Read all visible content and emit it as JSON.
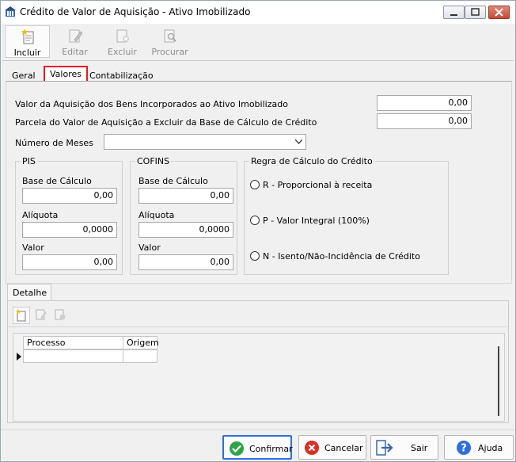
{
  "window": {
    "title": "Crédito de Valor de Aquisição - Ativo Imobilizado",
    "colors": {
      "accent": "#2f6fd6",
      "highlight": "#e31b23",
      "close": "#c64a35"
    }
  },
  "toolbar": {
    "incluir": "Incluir",
    "editar": "Editar",
    "excluir": "Excluir",
    "procurar": "Procurar"
  },
  "tabs": {
    "geral": "Geral",
    "valores": "Valores",
    "contabilizacao": "Contabilização"
  },
  "fields": {
    "valor_aquisicao_label": "Valor da Aquisição dos Bens Incorporados ao Ativo Imobilizado",
    "valor_aquisicao": "0,00",
    "parcela_label": "Parcela do Valor de Aquisição a Excluir da Base de Cálculo de Crédito",
    "parcela": "0,00",
    "numero_meses_label": "Número de Meses",
    "numero_meses": ""
  },
  "pis": {
    "title": "PIS",
    "base_label": "Base de Cálculo",
    "base": "0,00",
    "aliquota_label": "Alíquota",
    "aliquota": "0,0000",
    "valor_label": "Valor",
    "valor": "0,00"
  },
  "cofins": {
    "title": "COFINS",
    "base_label": "Base de Cálculo",
    "base": "0,00",
    "aliquota_label": "Alíquota",
    "aliquota": "0,0000",
    "valor_label": "Valor",
    "valor": "0,00"
  },
  "regra": {
    "title": "Regra de Cálculo do Crédito",
    "options": [
      "R - Proporcional à receita",
      "P - Valor Integral (100%)",
      "N - Isento/Não-Incidência de Crédito"
    ]
  },
  "detalhe": {
    "tab": "Detalhe",
    "columns": [
      "Processo",
      "Origem"
    ]
  },
  "actions": {
    "confirmar": "Confirmar",
    "cancelar": "Cancelar",
    "sair": "Sair",
    "ajuda": "Ajuda"
  }
}
